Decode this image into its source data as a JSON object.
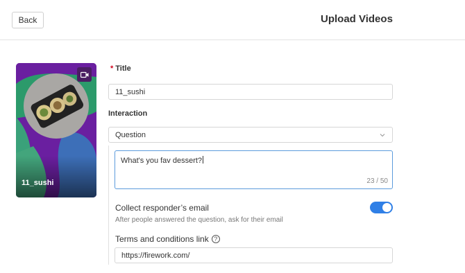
{
  "header": {
    "back_label": "Back",
    "title": "Upload Videos"
  },
  "thumbnail": {
    "label": "11_sushi",
    "badge_icon": "video-camera-icon"
  },
  "form": {
    "title": {
      "required_mark": "*",
      "label": "Title",
      "value": "11_sushi"
    },
    "interaction": {
      "label": "Interaction",
      "selected": "Question",
      "caret_icon": "chevron-down-icon"
    },
    "question": {
      "value": "What's you fav dessert?",
      "counter": "23 / 50"
    },
    "collect_email": {
      "label": "Collect responder’s email",
      "description": "After people answered the question, ask for their email",
      "enabled": true,
      "accent": "#2f7fe6"
    },
    "terms": {
      "label": "Terms and conditions link",
      "help_icon": "question-circle-icon",
      "value": "https://firework.com/"
    }
  }
}
